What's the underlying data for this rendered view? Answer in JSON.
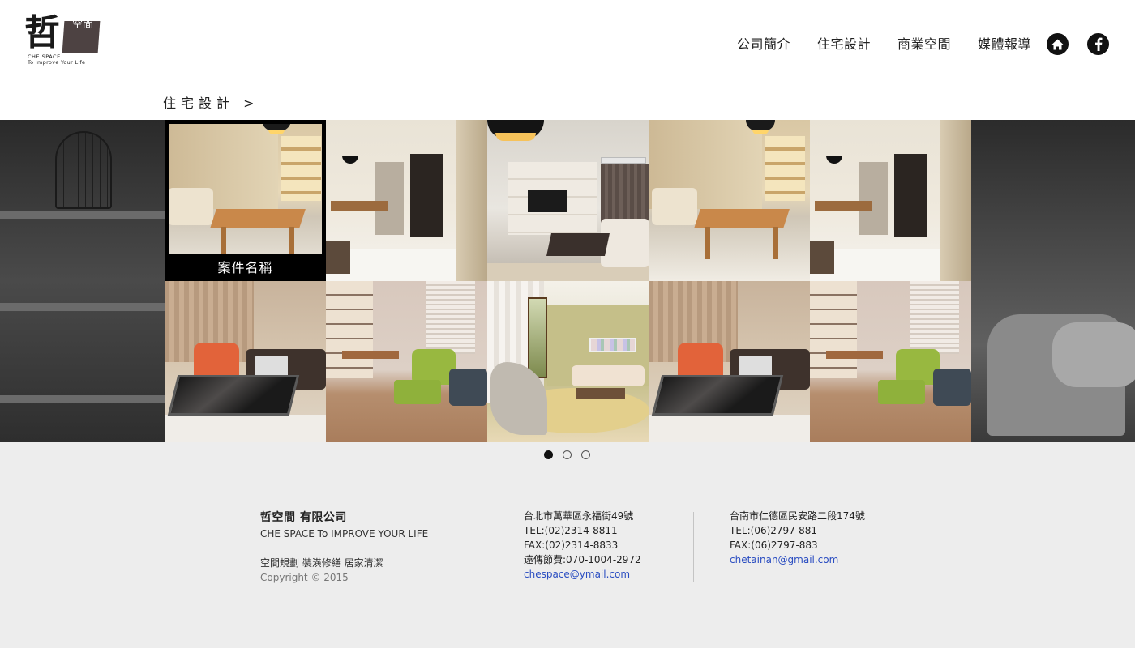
{
  "logo": {
    "glyph": "哲",
    "box_text": "空間",
    "tagline_1": "CHE SPACE",
    "tagline_2": "To Improve Your Life"
  },
  "nav": {
    "items": [
      {
        "label": "公司簡介"
      },
      {
        "label": "住宅設計"
      },
      {
        "label": "商業空間"
      },
      {
        "label": "媒體報導"
      }
    ],
    "home_icon": "home-icon",
    "facebook_icon": "facebook-icon"
  },
  "breadcrumb": "住宅設計 >",
  "gallery": {
    "hovered_caption": "案件名稱",
    "tiles": [
      {
        "scene": "dining-wood",
        "hovered": true
      },
      {
        "scene": "hallway-door"
      },
      {
        "scene": "living-tv"
      },
      {
        "scene": "dining-wood"
      },
      {
        "scene": "hallway-door"
      },
      {
        "scene": "orange-chair-office"
      },
      {
        "scene": "green-chairs-living"
      },
      {
        "scene": "modern-chair-living"
      },
      {
        "scene": "orange-chair-office"
      },
      {
        "scene": "green-chairs-living"
      }
    ]
  },
  "pagination": {
    "total": 3,
    "active": 1
  },
  "footer": {
    "company": "哲空間 有限公司",
    "slogan": "CHE SPACE To IMPROVE YOUR LIFE",
    "services": "空間規劃 裝潢修繕 居家清潔",
    "copyright": "Copyright © 2015",
    "taipei": {
      "address": "台北市萬華區永福街49號",
      "tel": "TEL:(02)2314-8811",
      "fax": "FAX:(02)2314-8833",
      "remote": "遠傳節費:070-1004-2972",
      "email": "chespace@ymail.com"
    },
    "tainan": {
      "address": "台南市仁德區民安路二段174號",
      "tel": "TEL:(06)2797-881",
      "fax": "FAX:(06)2797-883",
      "email": "chetainan@gmail.com"
    }
  },
  "colors": {
    "page_bg": "#ededed",
    "header_bg": "#ffffff",
    "link_blue": "#2a4dc1",
    "dark": "#111111"
  }
}
